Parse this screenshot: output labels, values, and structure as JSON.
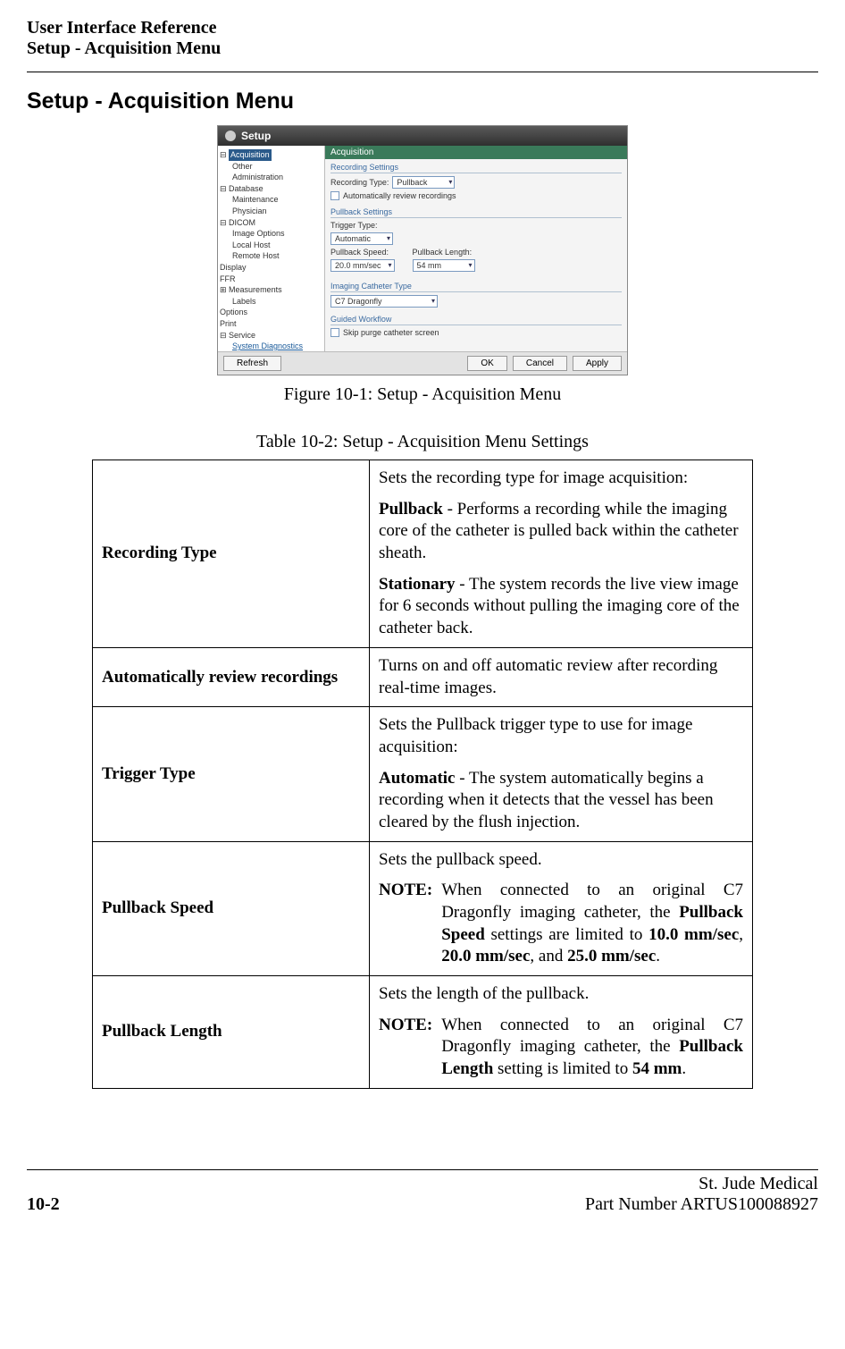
{
  "header": {
    "line1": "User Interface Reference",
    "line2": "Setup - Acquisition Menu"
  },
  "section_title": "Setup - Acquisition Menu",
  "figure": {
    "caption": "Figure 10-1:  Setup - Acquisition Menu",
    "window": {
      "title": "Setup",
      "tree": {
        "items": [
          {
            "label": "Acquisition",
            "selected": true,
            "level": 0,
            "expander": "-"
          },
          {
            "label": "Other",
            "level": 1
          },
          {
            "label": "Administration",
            "level": 1
          },
          {
            "label": "Database",
            "level": 0,
            "expander": "-"
          },
          {
            "label": "Maintenance",
            "level": 1
          },
          {
            "label": "Physician",
            "level": 1
          },
          {
            "label": "DICOM",
            "level": 0,
            "expander": "-"
          },
          {
            "label": "Image Options",
            "level": 1
          },
          {
            "label": "Local Host",
            "level": 1
          },
          {
            "label": "Remote Host",
            "level": 1
          },
          {
            "label": "Display",
            "level": 0
          },
          {
            "label": "FFR",
            "level": 0
          },
          {
            "label": "Measurements",
            "level": 0,
            "expander": "+"
          },
          {
            "label": "Labels",
            "level": 1
          },
          {
            "label": "Options",
            "level": 0
          },
          {
            "label": "Print",
            "level": 0
          },
          {
            "label": "Service",
            "level": 0,
            "expander": "-"
          },
          {
            "label": "System Diagnostics",
            "level": 1,
            "link": true
          }
        ]
      },
      "panel": {
        "heading": "Acquisition",
        "groups": {
          "recording": {
            "title": "Recording Settings",
            "type_label": "Recording Type:",
            "type_value": "Pullback",
            "auto_review_label": "Automatically review recordings"
          },
          "pullback": {
            "title": "Pullback Settings",
            "trigger_label": "Trigger Type:",
            "trigger_value": "Automatic",
            "speed_label": "Pullback Speed:",
            "speed_value": "20.0 mm/sec",
            "length_label": "Pullback Length:",
            "length_value": "54 mm"
          },
          "catheter": {
            "title": "Imaging Catheter Type",
            "value": "C7 Dragonfly"
          },
          "workflow": {
            "title": "Guided Workflow",
            "skip_label": "Skip purge catheter screen"
          }
        }
      },
      "buttons": {
        "refresh": "Refresh",
        "ok": "OK",
        "cancel": "Cancel",
        "apply": "Apply"
      }
    }
  },
  "table": {
    "caption": "Table 10-2:  Setup - Acquisition Menu Settings",
    "rows": {
      "recording_type": {
        "label": "Recording Type",
        "p1": "Sets the recording type for image acquisition:",
        "p2_b": "Pullback",
        "p2_rest": " - Performs a recording while the imaging core of the catheter is pulled back within the catheter sheath.",
        "p3_b": "Stationary",
        "p3_rest": " - The system records the live view image for 6 seconds without pulling the imaging core of the catheter back."
      },
      "auto_review": {
        "label": "Automatically review recordings",
        "p1": "Turns on and off automatic review after recording real-time images."
      },
      "trigger_type": {
        "label": "Trigger Type",
        "p1": "Sets the Pullback trigger type to use for image acquisition:",
        "p2_b": "Automatic",
        "p2_rest": " - The system automatically begins a recording when it detects that the vessel has been cleared by the flush injection."
      },
      "pullback_speed": {
        "label": "Pullback Speed",
        "p1": "Sets the pullback speed.",
        "note_label": "NOTE:",
        "note_pre": "When connected to an original C7 Dragonfly imaging catheter, the ",
        "note_b1": "Pullback Speed",
        "note_mid": " settings are limited to ",
        "note_b2": "10.0 mm/sec",
        "note_sep1": ", ",
        "note_b3": "20.0 mm/sec",
        "note_sep2": ", and ",
        "note_b4": "25.0 mm/sec",
        "note_end": "."
      },
      "pullback_length": {
        "label": "Pullback Length",
        "p1": "Sets the length of the pullback.",
        "note_label": "NOTE:",
        "note_pre": "When connected to an original C7 Dragonfly imaging catheter, the ",
        "note_b1": "Pullback Length",
        "note_mid": " setting is limited to ",
        "note_b2": "54 mm",
        "note_end": "."
      }
    }
  },
  "footer": {
    "page": "10-2",
    "company": "St. Jude Medical",
    "part": "Part Number ARTUS100088927"
  }
}
